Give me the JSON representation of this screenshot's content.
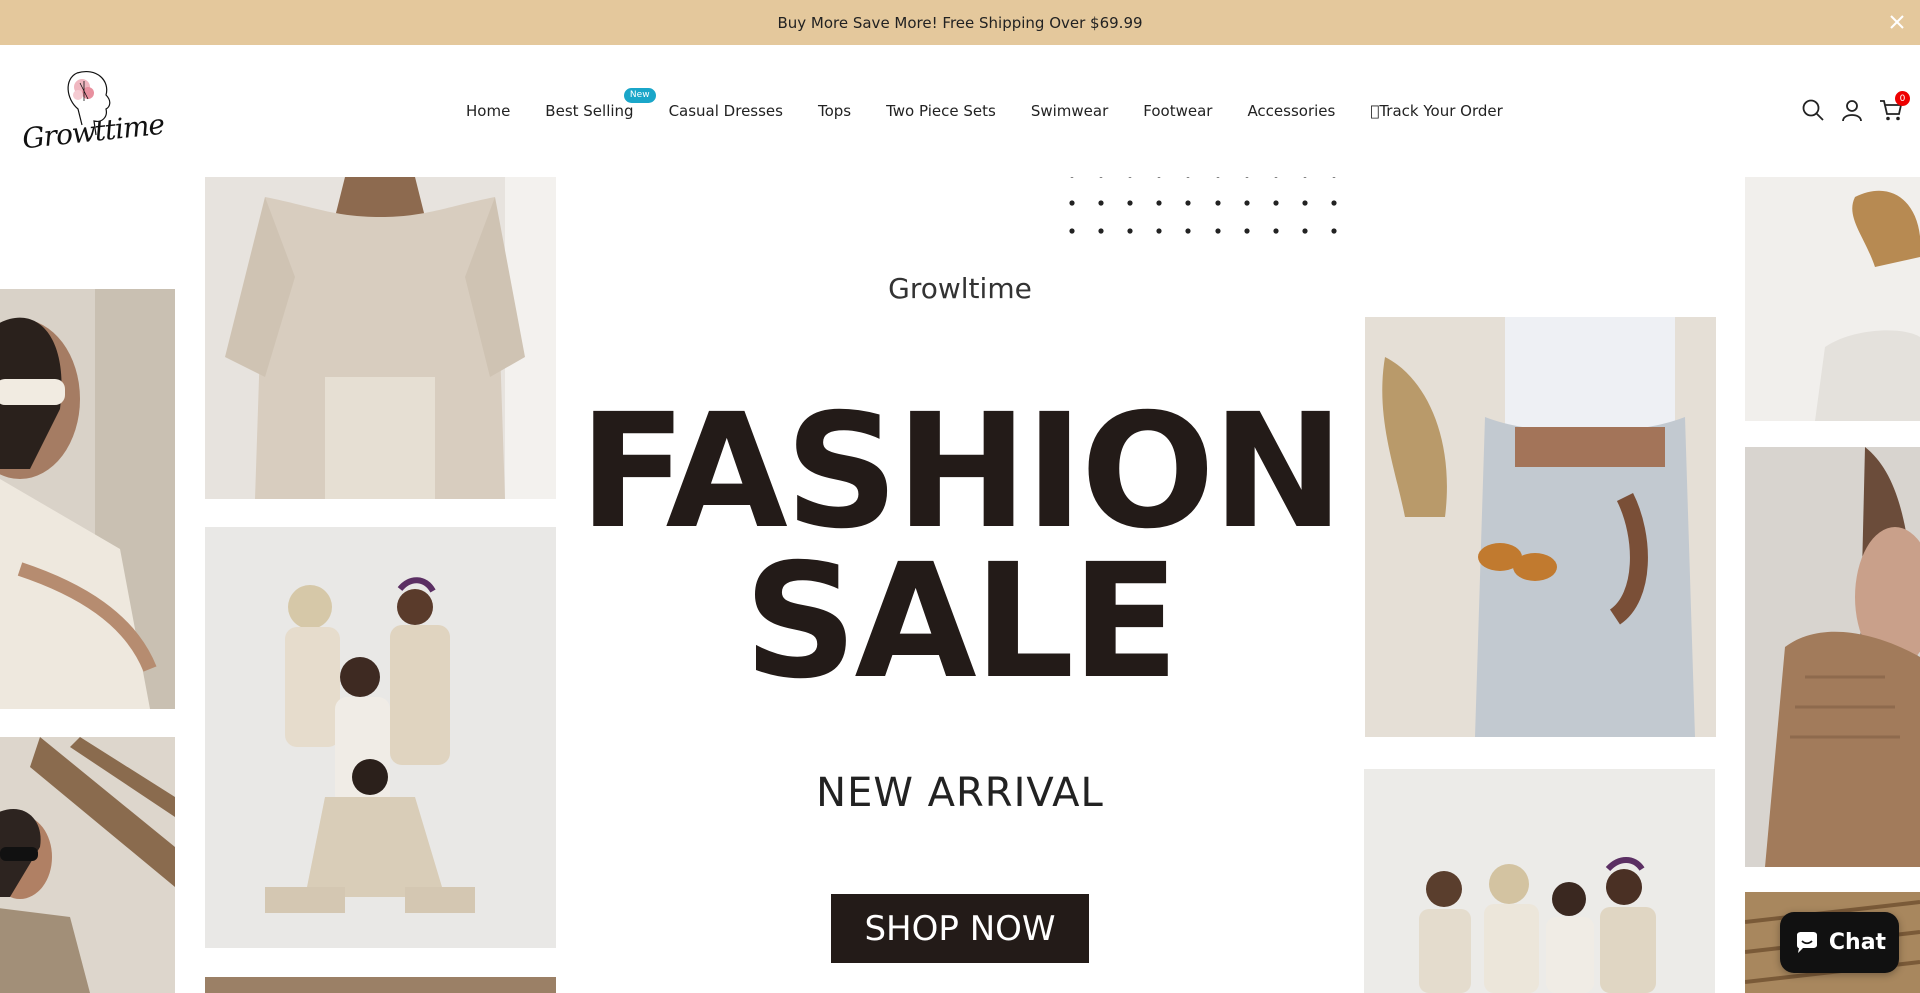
{
  "announcement": {
    "text": "Buy More Save More! Free Shipping Over $69.99",
    "close_icon": "close-icon"
  },
  "header": {
    "logo_text": "Growttime",
    "nav": [
      {
        "label": "Home"
      },
      {
        "label": "Best Selling",
        "badge": "New"
      },
      {
        "label": "Casual Dresses"
      },
      {
        "label": "Tops"
      },
      {
        "label": "Two Piece Sets"
      },
      {
        "label": "Swimwear"
      },
      {
        "label": "Footwear"
      },
      {
        "label": "Accessories"
      },
      {
        "label": "\u0000Track Your Order"
      }
    ],
    "icons": [
      "search-icon",
      "account-icon",
      "cart-icon"
    ],
    "cart_count": "0"
  },
  "hero": {
    "brand": "Growltime",
    "title_line1": "FASHION",
    "title_line2": "SALE",
    "subtitle": "NEW ARRIVAL",
    "cta": "SHOP NOW"
  },
  "chat": {
    "label": "Chat"
  },
  "colors": {
    "announce_bg": "#e4c89c",
    "badge": "#1aa6c9",
    "title": "#231b18",
    "button": "#231b18",
    "cart_badge": "#ee0000"
  }
}
